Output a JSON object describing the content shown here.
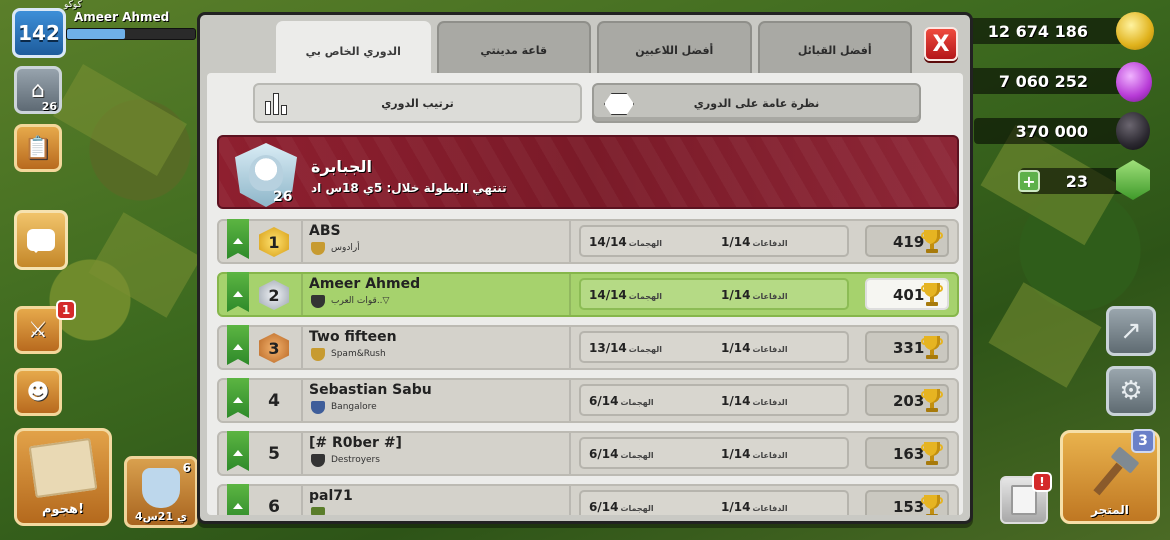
{
  "player": {
    "level": "142",
    "name": "Ameer Ahmed",
    "small_label": "كوكو"
  },
  "left_hud": {
    "builder_count": "26",
    "chat_icon": "chat-bubble-icon",
    "army_badge": "1",
    "attack_label": "هجوم!",
    "shield_label": "4ي 21س",
    "shield_count": "6"
  },
  "resources": {
    "gold": "12 674 186",
    "elixir": "7 060 252",
    "dark_elixir": "370 000",
    "gems": "23"
  },
  "right_hud": {
    "shop_label": "المتجر",
    "shop_badge": "3",
    "notice_badge": "!"
  },
  "modal": {
    "tabs": [
      {
        "label": "الدوري الخاص بي",
        "active": true
      },
      {
        "label": "قاعة مدينتي",
        "active": false
      },
      {
        "label": "أفضل اللاعبين",
        "active": false
      },
      {
        "label": "أفضل القبائل",
        "active": false
      }
    ],
    "close_label": "X",
    "subtabs": [
      {
        "label": "ترتيب الدوري",
        "icon": "bar-chart-icon",
        "active": false
      },
      {
        "label": "نظرة عامة على الدوري",
        "icon": "hexagon-icon",
        "active": true
      }
    ],
    "league": {
      "name": "الجبابرة",
      "ends_in": "تنتهي البطولة خلال: 5ي 18س اد",
      "badge_number": "26"
    },
    "rows": [
      {
        "rank": "1",
        "name": "ABS",
        "clan": "أرادوس",
        "attacks": "14/14",
        "attacks_label": "الهجمات",
        "defenses": "1/14",
        "defenses_label": "الدفاعات",
        "trophies": "419",
        "me": false
      },
      {
        "rank": "2",
        "name": "Ameer Ahmed",
        "clan": "قوات العرب..▽",
        "attacks": "14/14",
        "attacks_label": "الهجمات",
        "defenses": "1/14",
        "defenses_label": "الدفاعات",
        "trophies": "401",
        "me": true
      },
      {
        "rank": "3",
        "name": "Two fifteen",
        "clan": "Spam&Rush",
        "attacks": "13/14",
        "attacks_label": "الهجمات",
        "defenses": "1/14",
        "defenses_label": "الدفاعات",
        "trophies": "331",
        "me": false
      },
      {
        "rank": "4",
        "name": "Sebastian Sabu",
        "clan": "Bangalore",
        "attacks": "6/14",
        "attacks_label": "الهجمات",
        "defenses": "1/14",
        "defenses_label": "الدفاعات",
        "trophies": "203",
        "me": false
      },
      {
        "rank": "5",
        "name": "[# R0ber #]",
        "clan": "Destroyers",
        "attacks": "6/14",
        "attacks_label": "الهجمات",
        "defenses": "1/14",
        "defenses_label": "الدفاعات",
        "trophies": "163",
        "me": false
      },
      {
        "rank": "6",
        "name": "pal71",
        "clan": "",
        "attacks": "6/14",
        "attacks_label": "الهجمات",
        "defenses": "1/14",
        "defenses_label": "الدفاعات",
        "trophies": "153",
        "me": false
      }
    ]
  },
  "colors": {
    "banner": "#8e1f2f",
    "me_row": "#a6d26d",
    "close": "#d62828"
  }
}
